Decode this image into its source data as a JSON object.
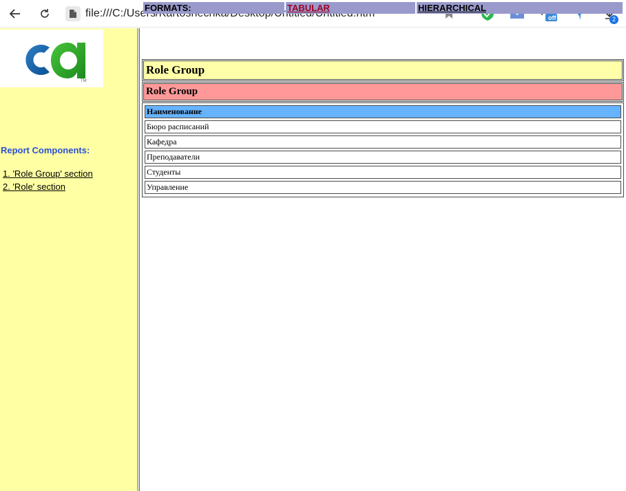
{
  "browser": {
    "url": "file:///C:/Users/Kartoshechka/Desktop/Untitled/Untitled.htm",
    "download_count": "2",
    "extension_off_label": "off"
  },
  "logo": {
    "text": "ca"
  },
  "sidebar": {
    "title": "Report Components:",
    "links": [
      "1. 'Role Group' section",
      "2. 'Role' section"
    ]
  },
  "formats": {
    "label": "FORMATS:",
    "tabular": "TABULAR",
    "hierarchical": "HIERARCHICAL"
  },
  "report": {
    "heading": "Role Group",
    "section_title": "Role Group",
    "table": {
      "header": "Наименование",
      "rows": [
        "Бюро расписаний",
        "Кафедра",
        "Преподаватели",
        "Студенты",
        "Управление"
      ]
    }
  },
  "colors": {
    "sidebar_bg": "#ffffa4",
    "formats_bg": "#9999cc",
    "heading_bg": "#ffffaa",
    "section_bg": "#ff9999",
    "table_header_bg": "#66b3ff",
    "link_accent": "#a00020",
    "components_title": "#2b4fd6"
  }
}
